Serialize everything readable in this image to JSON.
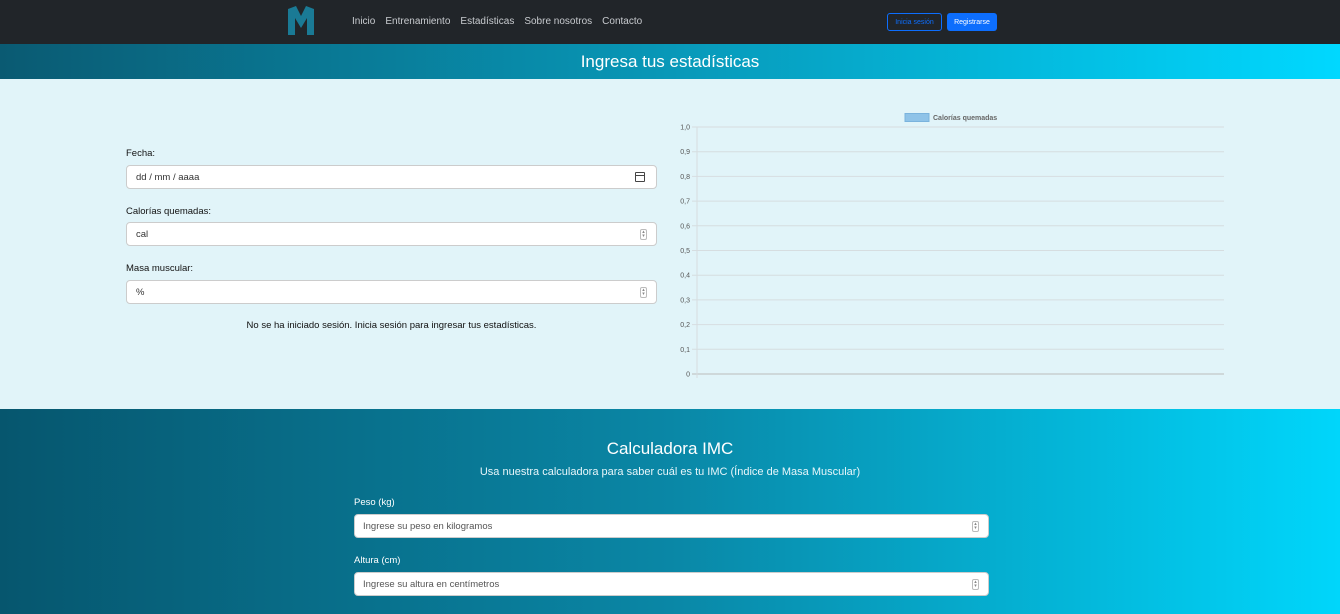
{
  "nav": {
    "logo": "M",
    "links": [
      "Inicio",
      "Entrenamiento",
      "Estadísticas",
      "Sobre nosotros",
      "Contacto"
    ],
    "login_label": "Inicia sesión",
    "register_label": "Registrarse"
  },
  "stats": {
    "title": "Ingresa tus estadísticas",
    "fecha_label": "Fecha:",
    "fecha_placeholder": "dd / mm / aaaa",
    "calorias_label": "Calorías quemadas:",
    "calorias_placeholder": "cal",
    "masa_label": "Masa muscular:",
    "masa_placeholder": "%",
    "notice": "No se ha iniciado sesión. Inicia sesión para ingresar tus estadísticas."
  },
  "chart_data": {
    "type": "bar",
    "categories": [],
    "series": [
      {
        "name": "Calorías quemadas",
        "values": []
      }
    ],
    "ylim": [
      0,
      1.0
    ],
    "yticks": [
      "0",
      "0,1",
      "0,2",
      "0,3",
      "0,4",
      "0,5",
      "0,6",
      "0,7",
      "0,8",
      "0,9",
      "1,0"
    ],
    "legend_position": "top",
    "grid": true,
    "colors": {
      "series": "#8fc3e8"
    }
  },
  "bmi": {
    "title": "Calculadora IMC",
    "subtitle": "Usa nuestra calculadora para saber cuál es tu IMC (Índice de Masa Muscular)",
    "peso_label": "Peso (kg)",
    "peso_placeholder": "Ingrese su peso en kilogramos",
    "altura_label": "Altura (cm)",
    "altura_placeholder": "Ingrese su altura en centímetros"
  }
}
